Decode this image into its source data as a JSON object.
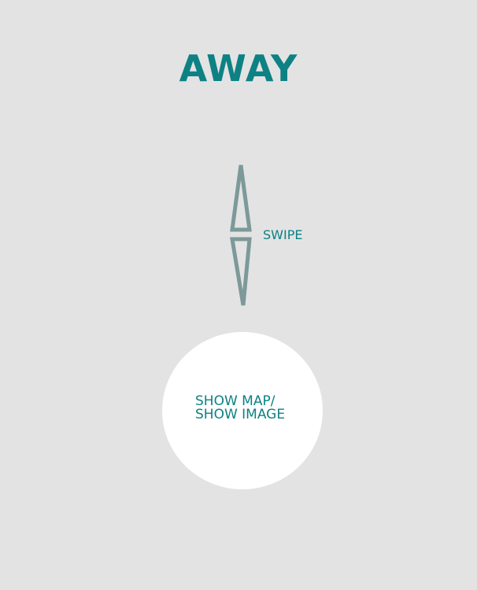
{
  "header": {
    "title": "AWAY"
  },
  "swipe": {
    "label": "SWIPE",
    "icon": "double-arrow-up-down-icon"
  },
  "toggle": {
    "line1": "SHOW MAP/",
    "line2": "SHOW IMAGE"
  },
  "colors": {
    "background": "#e3e3e3",
    "accent": "#0d8183",
    "arrow": "#7d9999",
    "circle": "#ffffff"
  }
}
